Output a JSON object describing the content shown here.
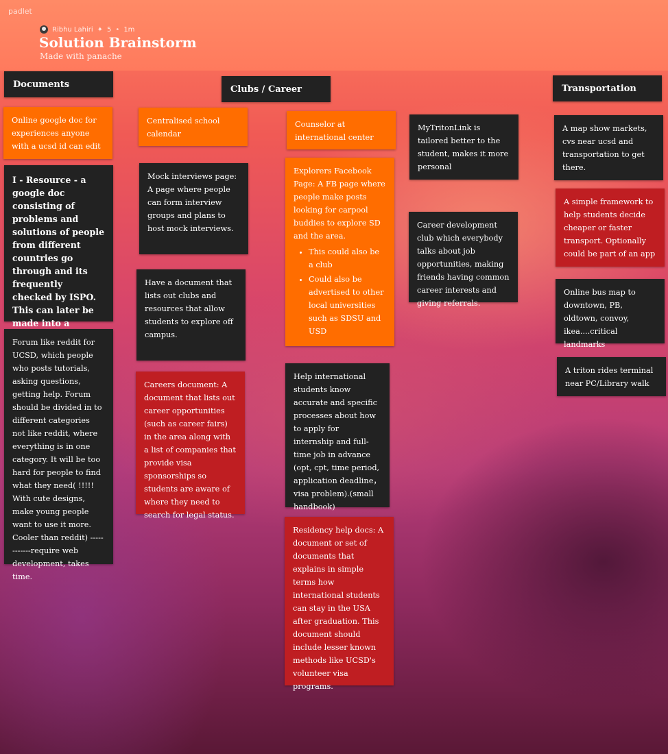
{
  "app": {
    "brand": "padlet"
  },
  "header": {
    "author": "Ribhu Lahiri",
    "star_icon": "sparkle-icon",
    "count": "5",
    "age": "1m",
    "title": "Solution Brainstorm",
    "subtitle": "Made with panache"
  },
  "columns": {
    "documents": "Documents",
    "clubs": "Clubs / Career",
    "transportation": "Transportation"
  },
  "cards": {
    "doc1": "Online google doc for experiences anyone with a ucsd id can edit",
    "doc2": "I - Resource - a google doc consisting of problems and solutions of people from different countries go through and its frequently checked by ISPO. This can later be made into a physical booklet.",
    "doc3": "Forum like reddit for UCSD, which people who posts tutorials, asking questions, getting help. Forum should be divided in to different categories not like reddit, where everything is in one category. It will be too hard for people to find what they need( !!!!! With cute designs, make young people want to use it more. Cooler than reddit) ------------require web development, takes time.",
    "c2_1": "Centralised school calendar",
    "c2_2": "Mock interviews page: A page where people can form interview groups and plans to host mock interviews.",
    "c2_3": "Have a document that lists out clubs and resources that allow students to explore off campus.",
    "c2_4": "Careers document: A document that lists out career opportunities (such as career fairs) in the area along with a list of companies that provide visa sponsorships so students are aware of where they need to search for legal status.",
    "c3_1": "Counselor at international center",
    "c3_2": "Explorers Facebook Page: A FB page where people make posts looking for carpool buddies to explore SD and the area.",
    "c3_2_b1": "This could also be a club",
    "c3_2_b2": "Could also be advertised to other local universities such as SDSU and USD",
    "c3_3": "Help international students know accurate and specific processes about how to apply for internship and full-time job in advance (opt, cpt, time period, application deadline，visa problem).(small handbook)",
    "c3_4": "Residency help docs: A document or set of documents that explains in simple terms how international students can stay in the USA after graduation. This document should include lesser known methods like UCSD's volunteer visa programs.",
    "c4_1": "MyTritonLink is tailored better to the student, makes it more personal",
    "c4_2": "Career development club which everybody talks about job opportunities, making friends having common career interests and giving referrals.",
    "t1": "A map show markets, cvs near ucsd and transportation to get there.",
    "t2": "A simple framework to help students decide cheaper or faster transport. Optionally could be part of an app",
    "t3": "Online bus map to downtown, PB, oldtown, convoy, ikea....critical landmarks",
    "t4": "A triton rides terminal near PC/Library walk"
  },
  "colors": {
    "dark": "#222222",
    "orange": "#ff6d00",
    "red": "#bf1e22",
    "header": "#ff7a5d"
  }
}
